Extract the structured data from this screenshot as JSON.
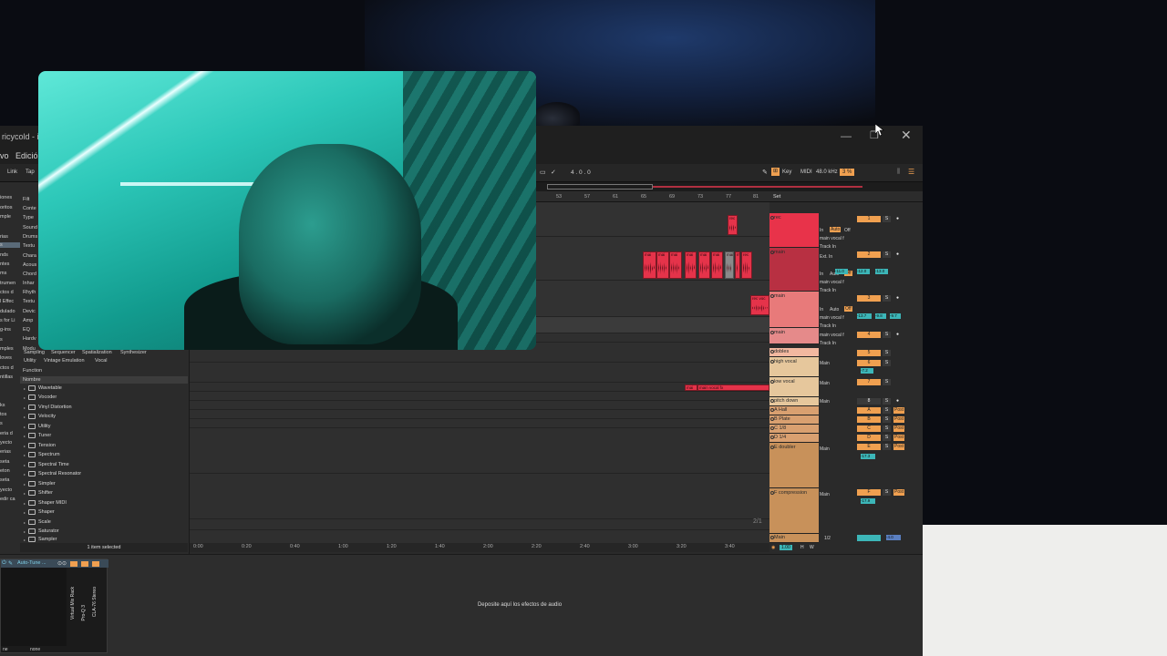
{
  "window": {
    "title": "ricycold - i",
    "minimize_icon": "—",
    "maximize_icon": "❐",
    "close_icon": "✕"
  },
  "menu": {
    "items": [
      "vo",
      "Edició"
    ]
  },
  "transport": {
    "link": "Link",
    "tap": "Tap",
    "position": "4 .  0 .  0",
    "key": "Key",
    "midi": "MIDI",
    "sample_rate": "48.0 kHz",
    "cpu": "3 %"
  },
  "ruler": {
    "bars": [
      "53",
      "57",
      "61",
      "65",
      "69",
      "73",
      "77",
      "81"
    ],
    "set_label": "Set"
  },
  "browser": {
    "categories": [
      "iones",
      "oritos",
      "mple",
      "",
      "rias",
      "s",
      "nds",
      "ntes",
      "ms",
      "trumen",
      "ctos d",
      "l Effec",
      "dulado",
      "s for Li",
      "g-ins",
      "s",
      "mples",
      "loves",
      "ctos d",
      "ntillas",
      "",
      "",
      "ks",
      "tos",
      "s",
      "eria d",
      "yecto",
      "erias",
      "seta",
      "eton",
      "seta",
      "yecto",
      "edir ca"
    ],
    "filter_label": "Filt",
    "filter_rows": [
      "Conte",
      "Type",
      "Sound",
      "Drums",
      "Textu",
      "Chara",
      "Acous",
      "Chord",
      "Inhar",
      "Rhyth",
      "Textu",
      "Devic",
      "Amp",
      "EQ",
      "Hardv",
      "Modu",
      "Pitch"
    ],
    "tags_row1": [
      "Sampling",
      "Sequencer",
      "Spatialization",
      "Synthesizer"
    ],
    "tags_row2": [
      "Utility",
      "Vintage Emulation",
      "Vocal"
    ],
    "function_label": "Function",
    "name_header": "Nombre",
    "items": [
      "Wavetable",
      "Vocoder",
      "Vinyl Distortion",
      "Velocity",
      "Utility",
      "Tuner",
      "Tension",
      "Spectrum",
      "Spectral Time",
      "Spectral Resonator",
      "Simpler",
      "Shifter",
      "Shaper MIDI",
      "Shaper",
      "Scale",
      "Saturator",
      "Sampler"
    ],
    "status": "1 item selected"
  },
  "arrangement": {
    "clips": [
      {
        "label": "rec"
      },
      {
        "label": "mai"
      },
      {
        "label": "mai"
      },
      {
        "label": "mai"
      },
      {
        "label": "mai"
      },
      {
        "label": "mai"
      },
      {
        "label": "mai"
      },
      {
        "label": "mai"
      },
      {
        "label": "mai"
      },
      {
        "label": "rec"
      },
      {
        "label": "rec voc"
      },
      {
        "label": "main vocal fx"
      }
    ],
    "pitch_clip_left": "mai",
    "time_labels": [
      "0:00",
      "0:20",
      "0:40",
      "1:00",
      "1:20",
      "1:40",
      "2:00",
      "2:20",
      "2:40",
      "3:00",
      "3:20",
      "3:40"
    ],
    "page_indicator": "2/1"
  },
  "tracks": [
    {
      "name": "rec",
      "color": "#e8334a"
    },
    {
      "name": "main",
      "color": "#e8334a"
    },
    {
      "name": "main",
      "color": "#e87a7a"
    },
    {
      "name": "main",
      "color": "#e58a8a"
    },
    {
      "name": "dobles",
      "color": "#f2b8a0"
    },
    {
      "name": "high vocal",
      "color": "#e6c79c"
    },
    {
      "name": "low vocal",
      "color": "#e6c79c"
    },
    {
      "name": "pitch down",
      "color": "#e6c79c"
    },
    {
      "name": "A Hall",
      "color": "#d9a070"
    },
    {
      "name": "B Plate",
      "color": "#d9a070"
    },
    {
      "name": "C 1/8",
      "color": "#d9a070"
    },
    {
      "name": "D 1/4",
      "color": "#d9a070"
    },
    {
      "name": "E doubler",
      "color": "#c8915a"
    },
    {
      "name": "F compression",
      "color": "#c8915a"
    },
    {
      "name": "Main",
      "color": "#c8915a"
    }
  ],
  "mixer": {
    "in": "In",
    "auto": "Auto",
    "off": "Off",
    "main_vocal": "main vocal f",
    "track_in": "Track In",
    "ext_in": "Ext. In",
    "main_route": "Main",
    "half": "1/2",
    "vol1": "-11.0",
    "vol2": "-12.0",
    "vol3": "-13.0",
    "vol4": "-13.7",
    "vol5": "-9.8",
    "vol6": "-9.7",
    "vol_high": "-7.2",
    "vol_e": "-17.3",
    "vol_f": "-17.9",
    "nums": [
      "1",
      "2",
      "3",
      "4",
      "5",
      "6",
      "7",
      "8"
    ],
    "sends": [
      "A",
      "B",
      "C",
      "D",
      "E",
      "F"
    ],
    "s": "S",
    "c": "C",
    "post": "Post",
    "master_vol": "-4.0",
    "bpm": "1.00",
    "h": "H",
    "w": "W"
  },
  "device": {
    "rack_title": "Auto-Tune ...",
    "drop_text": "Deposite aquí los efectos de audio",
    "plugins": [
      "Virtual Mix Rack",
      "Pro-Q 3",
      "CLA-76 Stereo"
    ],
    "none1": "ne",
    "none2": "none"
  }
}
